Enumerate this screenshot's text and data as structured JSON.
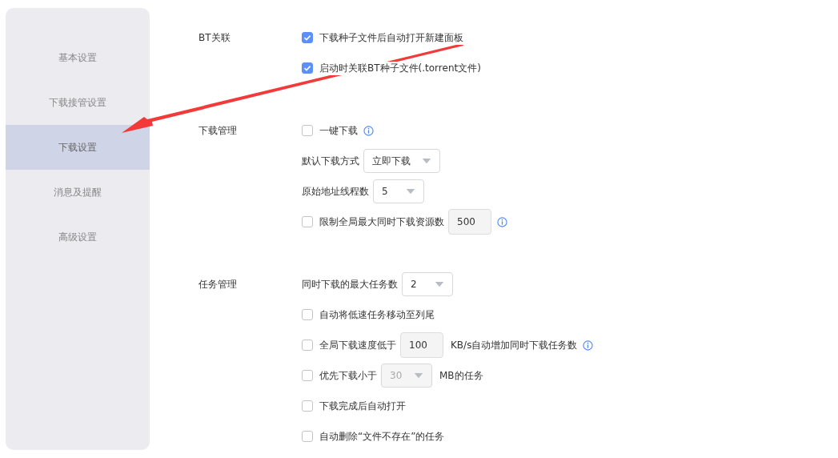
{
  "sidebar": {
    "items": [
      {
        "label": "基本设置",
        "selected": false
      },
      {
        "label": "下载接管设置",
        "selected": false
      },
      {
        "label": "下载设置",
        "selected": true
      },
      {
        "label": "消息及提醒",
        "selected": false
      },
      {
        "label": "高级设置",
        "selected": false
      }
    ]
  },
  "sections": [
    {
      "label": "BT关联",
      "rows": [
        {
          "kind": "checkbox",
          "checked": true,
          "label": "下载种子文件后自动打开新建面板"
        },
        {
          "kind": "checkbox",
          "checked": true,
          "label": "启动时关联BT种子文件(.torrent文件)"
        }
      ]
    },
    {
      "label": "下载管理",
      "rows": [
        {
          "kind": "checkbox",
          "checked": false,
          "label": "一键下载",
          "info": true
        },
        {
          "kind": "select",
          "label": "默认下载方式",
          "value": "立即下载",
          "disabled": false
        },
        {
          "kind": "select",
          "label": "原始地址线程数",
          "value": "5",
          "disabled": false
        },
        {
          "kind": "checkbox-field",
          "checked": false,
          "label": "限制全局最大同时下载资源数",
          "value": "500",
          "info": true
        }
      ]
    },
    {
      "label": "任务管理",
      "rows": [
        {
          "kind": "select",
          "label": "同时下载的最大任务数",
          "value": "2",
          "disabled": false
        },
        {
          "kind": "checkbox",
          "checked": false,
          "label": "自动将低速任务移动至列尾"
        },
        {
          "kind": "checkbox-field",
          "checked": false,
          "label": "全局下载速度低于",
          "value": "100",
          "suffix": "KB/s自动增加同时下载任务数",
          "info": true
        },
        {
          "kind": "checkbox-select",
          "checked": false,
          "label": "优先下载小于",
          "value": "30",
          "disabled": true,
          "suffix": "MB的任务"
        },
        {
          "kind": "checkbox",
          "checked": false,
          "label": "下载完成后自动打开"
        },
        {
          "kind": "checkbox",
          "checked": false,
          "label": "自动删除“文件不存在”的任务"
        }
      ]
    }
  ]
}
